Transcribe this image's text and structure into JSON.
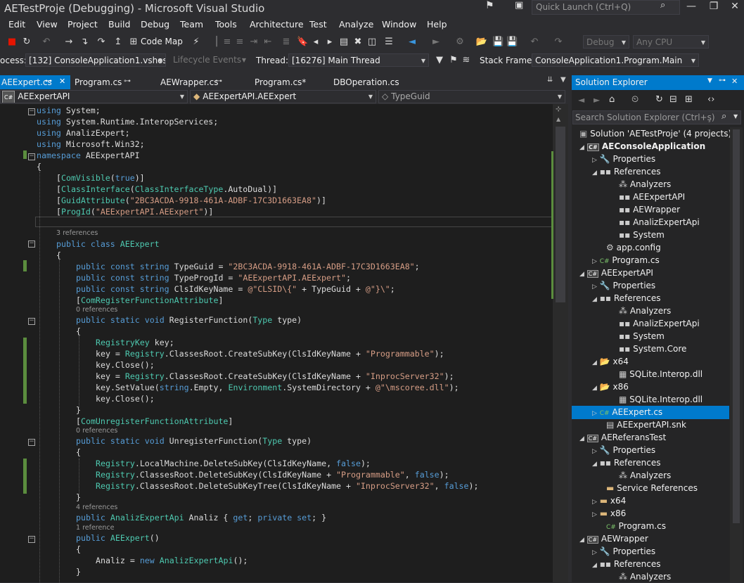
{
  "window": {
    "title": "AETestProje (Debugging) - Microsoft Visual Studio",
    "quick_launch_placeholder": "Quick Launch (Ctrl+Q)"
  },
  "menu": [
    "Edit",
    "View",
    "Project",
    "Build",
    "Debug",
    "Team",
    "Tools",
    "Architecture",
    "Test",
    "Analyze",
    "Window",
    "Help"
  ],
  "toolbar": {
    "code_map_label": "Code Map",
    "config": "Debug",
    "platform": "Any CPU"
  },
  "debugbar": {
    "process_label": "ocess:",
    "process_value": "[132] ConsoleApplication1.vshost.",
    "lifecycle_label": "Lifecycle Events",
    "thread_label": "Thread:",
    "thread_value": "[16276] Main Thread",
    "stackframe_label": "Stack Frame:",
    "stackframe_value": "ConsoleApplication1.Program.Main"
  },
  "tabs": [
    {
      "label": "AEExpert.cs",
      "active": true
    },
    {
      "label": "Program.cs"
    },
    {
      "label": "AEWrapper.cs"
    },
    {
      "label": "Program.cs*"
    },
    {
      "label": "DBOperation.cs"
    }
  ],
  "navbar": {
    "project": "AEExpertAPI",
    "class": "AEExpertAPI.AEExpert",
    "member": "TypeGuid"
  },
  "code": {
    "l1": "using System;",
    "l2": "using System.Runtime.InteropServices;",
    "l3": "using AnalizExpert;",
    "l4": "using Microsoft.Win32;",
    "l5_ns": "AEExpertAPI",
    "guid": "\"2BC3ACDA-9918-461A-ADBF-17C3D1663EA8\"",
    "progid": "\"AEExpertAPI.AEExpert\"",
    "clsid_a": "@\"CLSID\\{\"",
    "clsid_b": "@\"}\\\"",
    "programmable": "\"Programmable\"",
    "inproc": "\"InprocServer32\"",
    "mscoree": "@\"\\mscoree.dll\"",
    "refs_3": "3 references",
    "refs_0a": "0 references",
    "refs_0b": "0 references",
    "refs_4": "4 references",
    "refs_1": "1 reference"
  },
  "solution_explorer": {
    "title": "Solution Explorer",
    "search_placeholder": "Search Solution Explorer (Ctrl+ş)",
    "items": [
      {
        "label": "Solution 'AETestProje' (4 projects)"
      },
      {
        "label": "AEConsoleApplication"
      },
      {
        "label": "Properties"
      },
      {
        "label": "References"
      },
      {
        "label": "Analyzers"
      },
      {
        "label": "AEExpertAPI"
      },
      {
        "label": "AEWrapper"
      },
      {
        "label": "AnalizExpertApi"
      },
      {
        "label": "System"
      },
      {
        "label": "app.config"
      },
      {
        "label": "Program.cs"
      },
      {
        "label": "AEExpertAPI"
      },
      {
        "label": "Properties"
      },
      {
        "label": "References"
      },
      {
        "label": "Analyzers"
      },
      {
        "label": "AnalizExpertApi"
      },
      {
        "label": "System"
      },
      {
        "label": "System.Core"
      },
      {
        "label": "x64"
      },
      {
        "label": "SQLite.Interop.dll"
      },
      {
        "label": "x86"
      },
      {
        "label": "SQLite.Interop.dll"
      },
      {
        "label": "AEExpert.cs",
        "selected": true
      },
      {
        "label": "AEExpertAPI.snk"
      },
      {
        "label": "AEReferansTest"
      },
      {
        "label": "Properties"
      },
      {
        "label": "References"
      },
      {
        "label": "Analyzers"
      },
      {
        "label": "Service References"
      },
      {
        "label": "x64"
      },
      {
        "label": "x86"
      },
      {
        "label": "Program.cs"
      },
      {
        "label": "AEWrapper"
      },
      {
        "label": "Properties"
      },
      {
        "label": "References"
      },
      {
        "label": "Analyzers"
      }
    ]
  },
  "colors": {
    "accent": "#007acc",
    "editor_bg": "#1e1e1e",
    "keyword": "#569cd6",
    "type": "#4ec9b0",
    "string": "#d69d85"
  }
}
